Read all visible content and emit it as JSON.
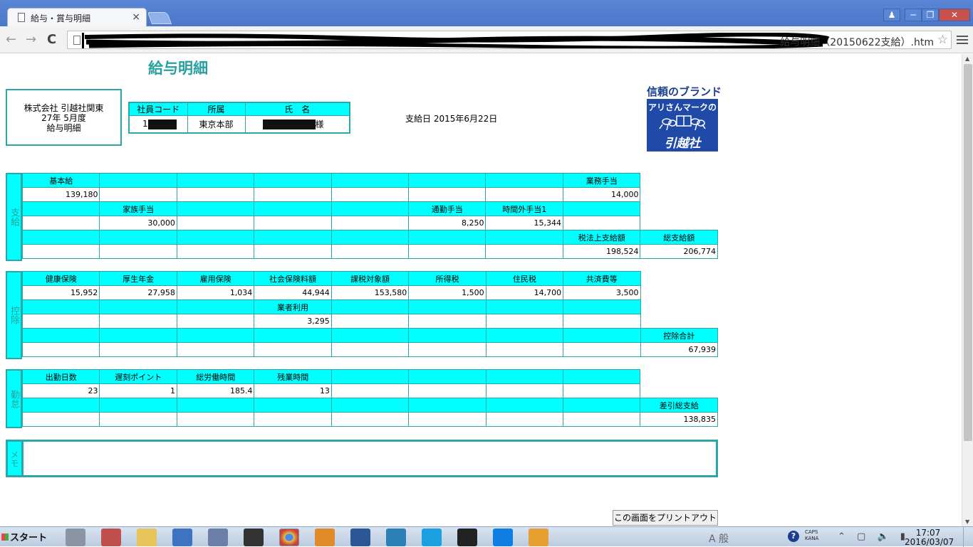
{
  "browser": {
    "tab_title": "給与・賞与明細",
    "tab_close": "×",
    "url_visible": "給与明細（20150622支給）.htm",
    "nav_back": "←",
    "nav_forward": "→",
    "nav_reload": "C",
    "star": "☆",
    "win_user": "♟",
    "win_min": "─",
    "win_max": "❐",
    "win_close": "✕"
  },
  "page": {
    "title": "給与明細",
    "company": {
      "name": "株式会社 引越社関東",
      "period": "27年 5月度",
      "doc": "給与明細"
    },
    "employee": {
      "headers": [
        "社員コード",
        "所属",
        "氏　名"
      ],
      "code_prefix": "1",
      "department": "東京本部",
      "honorific": "様"
    },
    "payday": "支給日 2015年6月22日",
    "brand": {
      "caption": "信頼のブランド",
      "logo_line1": "アリさんマークの",
      "logo_line2": "引越社"
    },
    "payments": {
      "side_label": "支給",
      "rows": [
        [
          {
            "t": "h",
            "v": "基本給"
          },
          {
            "t": "h",
            "v": ""
          },
          {
            "t": "h",
            "v": ""
          },
          {
            "t": "h",
            "v": ""
          },
          {
            "t": "h",
            "v": ""
          },
          {
            "t": "h",
            "v": ""
          },
          {
            "t": "h",
            "v": ""
          },
          {
            "t": "h",
            "v": "業務手当"
          },
          {
            "t": "e",
            "v": ""
          }
        ],
        [
          {
            "t": "v",
            "v": "139,180"
          },
          {
            "t": "v",
            "v": ""
          },
          {
            "t": "v",
            "v": ""
          },
          {
            "t": "v",
            "v": ""
          },
          {
            "t": "v",
            "v": ""
          },
          {
            "t": "v",
            "v": ""
          },
          {
            "t": "v",
            "v": ""
          },
          {
            "t": "v",
            "v": "14,000"
          },
          {
            "t": "e",
            "v": ""
          }
        ],
        [
          {
            "t": "h",
            "v": ""
          },
          {
            "t": "h",
            "v": "家族手当"
          },
          {
            "t": "h",
            "v": ""
          },
          {
            "t": "h",
            "v": ""
          },
          {
            "t": "h",
            "v": ""
          },
          {
            "t": "h",
            "v": "通勤手当"
          },
          {
            "t": "h",
            "v": "時間外手当1"
          },
          {
            "t": "h",
            "v": ""
          },
          {
            "t": "e",
            "v": ""
          }
        ],
        [
          {
            "t": "v",
            "v": ""
          },
          {
            "t": "v",
            "v": "30,000"
          },
          {
            "t": "v",
            "v": ""
          },
          {
            "t": "v",
            "v": ""
          },
          {
            "t": "v",
            "v": ""
          },
          {
            "t": "v",
            "v": "8,250"
          },
          {
            "t": "v",
            "v": "15,344"
          },
          {
            "t": "v",
            "v": ""
          },
          {
            "t": "e",
            "v": ""
          }
        ],
        [
          {
            "t": "h",
            "v": ""
          },
          {
            "t": "h",
            "v": ""
          },
          {
            "t": "h",
            "v": ""
          },
          {
            "t": "h",
            "v": ""
          },
          {
            "t": "h",
            "v": ""
          },
          {
            "t": "h",
            "v": ""
          },
          {
            "t": "h",
            "v": ""
          },
          {
            "t": "h",
            "v": "税法上支給額"
          },
          {
            "t": "h",
            "v": "総支給額"
          }
        ],
        [
          {
            "t": "v",
            "v": ""
          },
          {
            "t": "v",
            "v": ""
          },
          {
            "t": "v",
            "v": ""
          },
          {
            "t": "v",
            "v": ""
          },
          {
            "t": "v",
            "v": ""
          },
          {
            "t": "v",
            "v": ""
          },
          {
            "t": "v",
            "v": ""
          },
          {
            "t": "v",
            "v": "198,524"
          },
          {
            "t": "v",
            "v": "206,774"
          }
        ]
      ]
    },
    "deductions": {
      "side_label": "控除",
      "rows": [
        [
          {
            "t": "h",
            "v": "健康保険"
          },
          {
            "t": "h",
            "v": "厚生年金"
          },
          {
            "t": "h",
            "v": "雇用保険"
          },
          {
            "t": "h",
            "v": "社会保険料額"
          },
          {
            "t": "h",
            "v": "課税対象額"
          },
          {
            "t": "h",
            "v": "所得税"
          },
          {
            "t": "h",
            "v": "住民税"
          },
          {
            "t": "h",
            "v": "共済費等"
          },
          {
            "t": "e",
            "v": ""
          }
        ],
        [
          {
            "t": "v",
            "v": "15,952"
          },
          {
            "t": "v",
            "v": "27,958"
          },
          {
            "t": "v",
            "v": "1,034"
          },
          {
            "t": "v",
            "v": "44,944"
          },
          {
            "t": "v",
            "v": "153,580"
          },
          {
            "t": "v",
            "v": "1,500"
          },
          {
            "t": "v",
            "v": "14,700"
          },
          {
            "t": "v",
            "v": "3,500"
          },
          {
            "t": "e",
            "v": ""
          }
        ],
        [
          {
            "t": "h",
            "v": ""
          },
          {
            "t": "h",
            "v": ""
          },
          {
            "t": "h",
            "v": ""
          },
          {
            "t": "h",
            "v": "業者利用"
          },
          {
            "t": "h",
            "v": ""
          },
          {
            "t": "h",
            "v": ""
          },
          {
            "t": "h",
            "v": ""
          },
          {
            "t": "h",
            "v": ""
          },
          {
            "t": "e",
            "v": ""
          }
        ],
        [
          {
            "t": "v",
            "v": ""
          },
          {
            "t": "v",
            "v": ""
          },
          {
            "t": "v",
            "v": ""
          },
          {
            "t": "v",
            "v": "3,295"
          },
          {
            "t": "v",
            "v": ""
          },
          {
            "t": "v",
            "v": ""
          },
          {
            "t": "v",
            "v": ""
          },
          {
            "t": "v",
            "v": ""
          },
          {
            "t": "e",
            "v": ""
          }
        ],
        [
          {
            "t": "h",
            "v": ""
          },
          {
            "t": "h",
            "v": ""
          },
          {
            "t": "h",
            "v": ""
          },
          {
            "t": "h",
            "v": ""
          },
          {
            "t": "h",
            "v": ""
          },
          {
            "t": "h",
            "v": ""
          },
          {
            "t": "h",
            "v": ""
          },
          {
            "t": "h",
            "v": ""
          },
          {
            "t": "h",
            "v": "控除合計"
          }
        ],
        [
          {
            "t": "v",
            "v": ""
          },
          {
            "t": "v",
            "v": ""
          },
          {
            "t": "v",
            "v": ""
          },
          {
            "t": "v",
            "v": ""
          },
          {
            "t": "v",
            "v": ""
          },
          {
            "t": "v",
            "v": ""
          },
          {
            "t": "v",
            "v": ""
          },
          {
            "t": "v",
            "v": ""
          },
          {
            "t": "v",
            "v": "67,939"
          }
        ]
      ]
    },
    "attendance": {
      "side_label": "勤怠",
      "rows": [
        [
          {
            "t": "h",
            "v": "出勤日数"
          },
          {
            "t": "h",
            "v": "遅刻ポイント"
          },
          {
            "t": "h",
            "v": "総労働時間"
          },
          {
            "t": "h",
            "v": "残業時間"
          },
          {
            "t": "h",
            "v": ""
          },
          {
            "t": "h",
            "v": ""
          },
          {
            "t": "h",
            "v": ""
          },
          {
            "t": "h",
            "v": ""
          },
          {
            "t": "e",
            "v": ""
          }
        ],
        [
          {
            "t": "v",
            "v": "23"
          },
          {
            "t": "v",
            "v": "1"
          },
          {
            "t": "v",
            "v": "185.4"
          },
          {
            "t": "v",
            "v": "13"
          },
          {
            "t": "v",
            "v": ""
          },
          {
            "t": "v",
            "v": ""
          },
          {
            "t": "v",
            "v": ""
          },
          {
            "t": "v",
            "v": ""
          },
          {
            "t": "e",
            "v": ""
          }
        ],
        [
          {
            "t": "h",
            "v": ""
          },
          {
            "t": "h",
            "v": ""
          },
          {
            "t": "h",
            "v": ""
          },
          {
            "t": "h",
            "v": ""
          },
          {
            "t": "h",
            "v": ""
          },
          {
            "t": "h",
            "v": ""
          },
          {
            "t": "h",
            "v": ""
          },
          {
            "t": "h",
            "v": ""
          },
          {
            "t": "h",
            "v": "差引総支給"
          }
        ],
        [
          {
            "t": "v",
            "v": ""
          },
          {
            "t": "v",
            "v": ""
          },
          {
            "t": "v",
            "v": ""
          },
          {
            "t": "v",
            "v": ""
          },
          {
            "t": "v",
            "v": ""
          },
          {
            "t": "v",
            "v": ""
          },
          {
            "t": "v",
            "v": ""
          },
          {
            "t": "v",
            "v": ""
          },
          {
            "t": "v",
            "v": "138,835"
          }
        ]
      ]
    },
    "memo_label": "メモ",
    "print_button": "この画面をプリントアウト"
  },
  "taskbar": {
    "start_label": "スタート",
    "tray_text": "A 般",
    "help": "?",
    "caps": "CAPS",
    "kana": "KANA",
    "tray_icons": "⌃ ▢ 🔈 ▮",
    "time": "17:07",
    "date": "2016/03/07",
    "apps": [
      {
        "name": "computer",
        "color": "#8c95a6"
      },
      {
        "name": "tools",
        "color": "#c0504d"
      },
      {
        "name": "folder",
        "color": "#e8c55a"
      },
      {
        "name": "signal",
        "color": "#3e73c4"
      },
      {
        "name": "people",
        "color": "#6b7fa8"
      },
      {
        "name": "printer",
        "color": "#333333"
      },
      {
        "name": "chrome",
        "color": "#e0c44a"
      },
      {
        "name": "media",
        "color": "#e08a2a"
      },
      {
        "name": "word",
        "color": "#2b5797"
      },
      {
        "name": "network",
        "color": "#2d7fb8"
      },
      {
        "name": "ie",
        "color": "#1ba1e2"
      },
      {
        "name": "amazon",
        "color": "#222222"
      },
      {
        "name": "dropbox",
        "color": "#0f7ee3"
      },
      {
        "name": "outlook",
        "color": "#e8a030"
      }
    ]
  }
}
